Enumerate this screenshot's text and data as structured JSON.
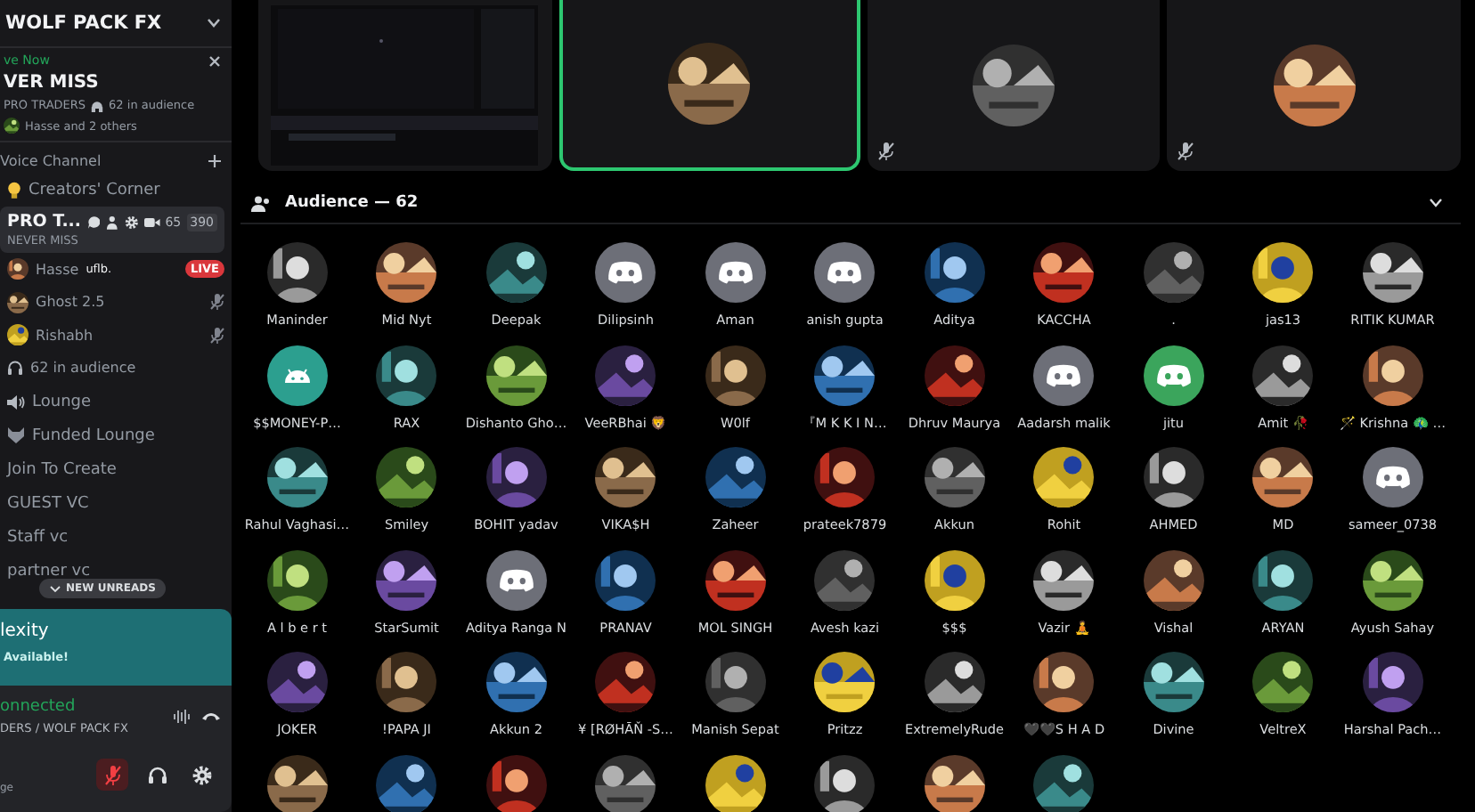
{
  "server": {
    "name": "WOLF PACK FX"
  },
  "live_banner": {
    "label": "ve Now",
    "title": "VER MISS",
    "channel": "PRO TRADERS",
    "audience": "62 in audience",
    "participants": "Hasse and 2 others"
  },
  "category": {
    "name": "Voice Channel"
  },
  "channels": [
    {
      "kind": "bulb",
      "name": "Creators' Corner",
      "selected": false
    },
    {
      "kind": "stage",
      "name": "PRO T...",
      "subtitle": "NEVER MISS",
      "count": "65",
      "limit": "390",
      "selected": true,
      "members": [
        {
          "name": "Hasse",
          "tag": "uflb.",
          "live": true,
          "badge": "LIVE",
          "muted": false
        },
        {
          "name": "Ghost 2.5",
          "live": false,
          "muted": true
        },
        {
          "name": "Rishabh",
          "live": false,
          "muted": true
        }
      ],
      "audience": "62 in audience"
    },
    {
      "kind": "speaker",
      "name": "Lounge",
      "selected": false
    },
    {
      "kind": "wolf",
      "name": "Funded Lounge",
      "selected": false
    },
    {
      "kind": "plain",
      "name": "Join To Create",
      "selected": false
    },
    {
      "kind": "plain",
      "name": "GUEST VC",
      "selected": false
    },
    {
      "kind": "plain",
      "name": "Staff vc",
      "selected": false
    },
    {
      "kind": "plain",
      "name": "partner vc",
      "selected": false
    }
  ],
  "unreads_pill": "NEW UNREADS",
  "activity_card": {
    "title": "lexity",
    "status": "Available!"
  },
  "voice_status": {
    "status": "onnected",
    "channel": "DERS / WOLF PACK FX"
  },
  "user_panel": {
    "name": "ge",
    "mic_muted": true
  },
  "stage_tiles": [
    {
      "kind": "screen",
      "selected": false,
      "muted": false
    },
    {
      "kind": "avatar",
      "selected": true,
      "muted": false
    },
    {
      "kind": "avatar",
      "selected": false,
      "muted": true
    },
    {
      "kind": "avatar",
      "selected": false,
      "muted": true
    }
  ],
  "audience": {
    "title": "Audience — 62",
    "members": [
      {
        "kind": "picture",
        "name": "Maninder"
      },
      {
        "kind": "picture",
        "name": "Mid Nyt"
      },
      {
        "kind": "picture",
        "name": "Deepak"
      },
      {
        "kind": "default",
        "name": "Dilipsinh",
        "color": "#6d6f78"
      },
      {
        "kind": "default",
        "name": "Aman",
        "color": "#6d6f78"
      },
      {
        "kind": "default",
        "name": "anish gupta",
        "color": "#6d6f78"
      },
      {
        "kind": "picture",
        "name": "Aditya"
      },
      {
        "kind": "picture",
        "name": "KACCHA"
      },
      {
        "kind": "picture",
        "name": "."
      },
      {
        "kind": "picture",
        "name": "jas13"
      },
      {
        "kind": "picture",
        "name": "RITIK KUMAR"
      },
      {
        "kind": "android",
        "name": "$$MONEY-P…",
        "color": "#2c9f8f"
      },
      {
        "kind": "picture",
        "name": "RAX"
      },
      {
        "kind": "picture",
        "name": "Dishanto Gho…"
      },
      {
        "kind": "picture",
        "name": "VeeRBhai 🦁"
      },
      {
        "kind": "picture",
        "name": "W0lf"
      },
      {
        "kind": "picture",
        "name": "『M K K I N…"
      },
      {
        "kind": "picture",
        "name": "Dhruv Maurya"
      },
      {
        "kind": "default",
        "name": "Aadarsh malik",
        "color": "#6d6f78"
      },
      {
        "kind": "default",
        "name": "jitu",
        "color": "#3ba55c"
      },
      {
        "kind": "picture",
        "name": "Amit 🥀"
      },
      {
        "kind": "picture",
        "name": "🪄 Krishna 🦚 …"
      },
      {
        "kind": "picture",
        "name": "Rahul Vaghasi…"
      },
      {
        "kind": "picture",
        "name": "Smiley"
      },
      {
        "kind": "picture",
        "name": "BOHIT yadav"
      },
      {
        "kind": "picture",
        "name": "VIKA$H"
      },
      {
        "kind": "picture",
        "name": "Zaheer"
      },
      {
        "kind": "picture",
        "name": "prateek7879"
      },
      {
        "kind": "picture",
        "name": "Akkun"
      },
      {
        "kind": "picture",
        "name": "Rohit"
      },
      {
        "kind": "picture",
        "name": "AHMED"
      },
      {
        "kind": "picture",
        "name": "MD"
      },
      {
        "kind": "default",
        "name": "sameer_0738",
        "color": "#6d6f78"
      },
      {
        "kind": "picture",
        "name": "A l b e r t"
      },
      {
        "kind": "picture",
        "name": "StarSumit"
      },
      {
        "kind": "default",
        "name": "Aditya Ranga N",
        "color": "#6d6f78"
      },
      {
        "kind": "picture",
        "name": "PRANAV"
      },
      {
        "kind": "picture",
        "name": "MOL SINGH"
      },
      {
        "kind": "picture",
        "name": "Avesh kazi"
      },
      {
        "kind": "picture",
        "name": "$$$"
      },
      {
        "kind": "picture",
        "name": "Vazir 🧘"
      },
      {
        "kind": "picture",
        "name": "Vishal"
      },
      {
        "kind": "picture",
        "name": "ARYAN"
      },
      {
        "kind": "picture",
        "name": "Ayush Sahay"
      },
      {
        "kind": "picture",
        "name": "JOKER"
      },
      {
        "kind": "picture",
        "name": "!PAPA JI"
      },
      {
        "kind": "picture",
        "name": "Akkun 2"
      },
      {
        "kind": "picture",
        "name": "¥ [RØHĀŇ -S…"
      },
      {
        "kind": "picture",
        "name": "Manish Sepat"
      },
      {
        "kind": "picture",
        "name": "Pritzz"
      },
      {
        "kind": "picture",
        "name": "ExtremelyRude"
      },
      {
        "kind": "picture",
        "name": "🖤🖤S H A D"
      },
      {
        "kind": "picture",
        "name": "Divine"
      },
      {
        "kind": "picture",
        "name": "VeltreX"
      },
      {
        "kind": "picture",
        "name": "Harshal Pach…"
      },
      {
        "kind": "picture"
      },
      {
        "kind": "picture"
      },
      {
        "kind": "picture"
      },
      {
        "kind": "picture"
      },
      {
        "kind": "picture"
      },
      {
        "kind": "picture"
      },
      {
        "kind": "picture"
      },
      {
        "kind": "picture"
      }
    ]
  }
}
